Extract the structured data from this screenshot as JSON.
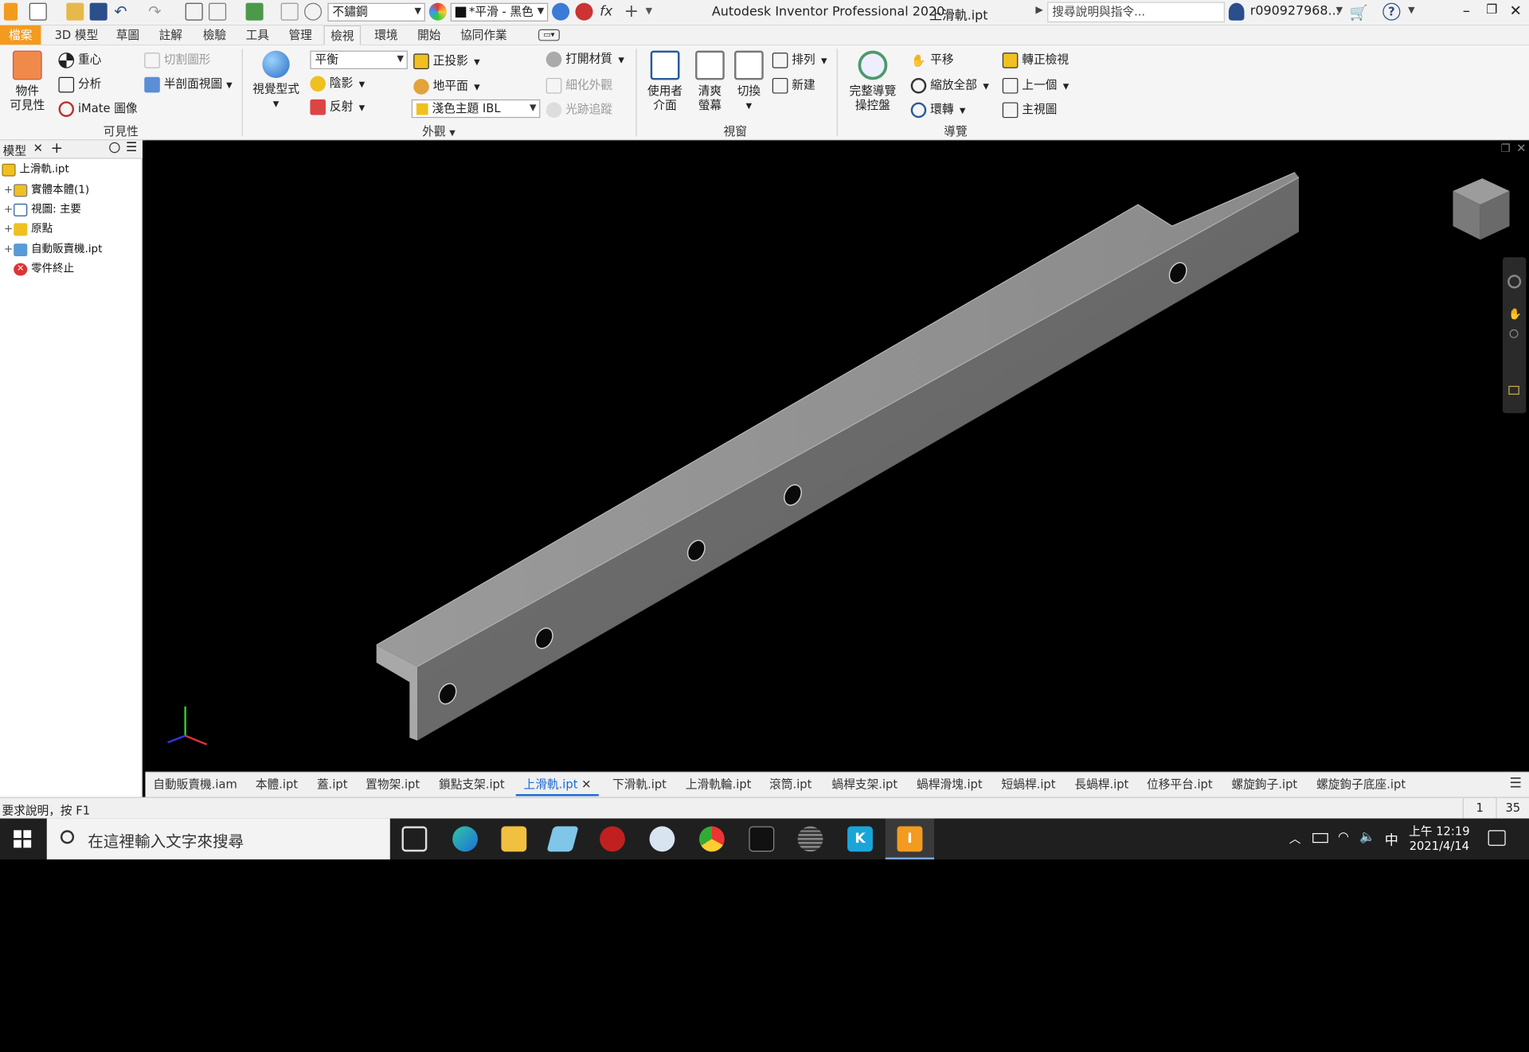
{
  "titlebar": {
    "title": "Autodesk Inventor Professional 2020",
    "doc": "上滑軌.ipt",
    "material": "不鏽鋼",
    "appearance": "*平滑 - 黑色",
    "search_placeholder": "搜尋說明與指令...",
    "user": "r090927968...",
    "fx": "fx"
  },
  "ribbon_tabs": [
    {
      "label": "檔案"
    },
    {
      "label": "3D 模型"
    },
    {
      "label": "草圖"
    },
    {
      "label": "註解"
    },
    {
      "label": "檢驗"
    },
    {
      "label": "工具"
    },
    {
      "label": "管理"
    },
    {
      "label": "檢視"
    },
    {
      "label": "環境"
    },
    {
      "label": "開始"
    },
    {
      "label": "協同作業"
    }
  ],
  "ribbon": {
    "visibility": {
      "label": "可見性",
      "object_vis": "物件\n可見性",
      "center": "重心",
      "analysis": "分析",
      "imate": "iMate 圖像",
      "slice": "切割圖形",
      "half_section": "半剖面視圖"
    },
    "appearance": {
      "label": "外觀",
      "visual_style": "視覺型式",
      "balance": "平衡",
      "shadow": "陰影",
      "reflection": "反射",
      "ortho": "正投影",
      "ground": "地平面",
      "ibl": "淺色主題 IBL",
      "open_material": "打開材質",
      "refine": "細化外觀",
      "raytrace": "光跡追蹤"
    },
    "window": {
      "label": "視窗",
      "ui": "使用者\n介面",
      "clean": "清爽\n螢幕",
      "switch": "切換",
      "arrange": "排列",
      "new": "新建"
    },
    "nav": {
      "label": "導覽",
      "full_nav": "完整導覽\n操控盤",
      "pan": "平移",
      "zoom_all": "縮放全部",
      "orbit": "環轉",
      "look_at": "轉正檢視",
      "prev": "上一個",
      "home": "主視圖"
    }
  },
  "browser": {
    "title": "模型",
    "items": [
      {
        "label": "上滑軌.ipt"
      },
      {
        "label": "實體本體(1)"
      },
      {
        "label": "視圖: 主要"
      },
      {
        "label": "原點"
      },
      {
        "label": "自動販賣機.ipt"
      },
      {
        "label": "零件終止"
      }
    ]
  },
  "doc_tabs": [
    {
      "label": "自動販賣機.iam"
    },
    {
      "label": "本體.ipt"
    },
    {
      "label": "蓋.ipt"
    },
    {
      "label": "置物架.ipt"
    },
    {
      "label": "鎖點支架.ipt"
    },
    {
      "label": "上滑軌.ipt"
    },
    {
      "label": "下滑軌.ipt"
    },
    {
      "label": "上滑軌輪.ipt"
    },
    {
      "label": "滾筒.ipt"
    },
    {
      "label": "蝸桿支架.ipt"
    },
    {
      "label": "蝸桿滑塊.ipt"
    },
    {
      "label": "短蝸桿.ipt"
    },
    {
      "label": "長蝸桿.ipt"
    },
    {
      "label": "位移平台.ipt"
    },
    {
      "label": "螺旋鉤子.ipt"
    },
    {
      "label": "螺旋鉤子底座.ipt"
    }
  ],
  "status": {
    "help": "要求說明，按 F1",
    "n1": "1",
    "n2": "35"
  },
  "taskbar": {
    "search": "在這裡輸入文字來搜尋",
    "time": "上午 12:19",
    "date": "2021/4/14",
    "ime": "中"
  },
  "colors": {
    "accent": "#1a6ad1",
    "file_tab": "#f29b1f",
    "viewport": "#000000",
    "part": "#6e6e6e"
  }
}
